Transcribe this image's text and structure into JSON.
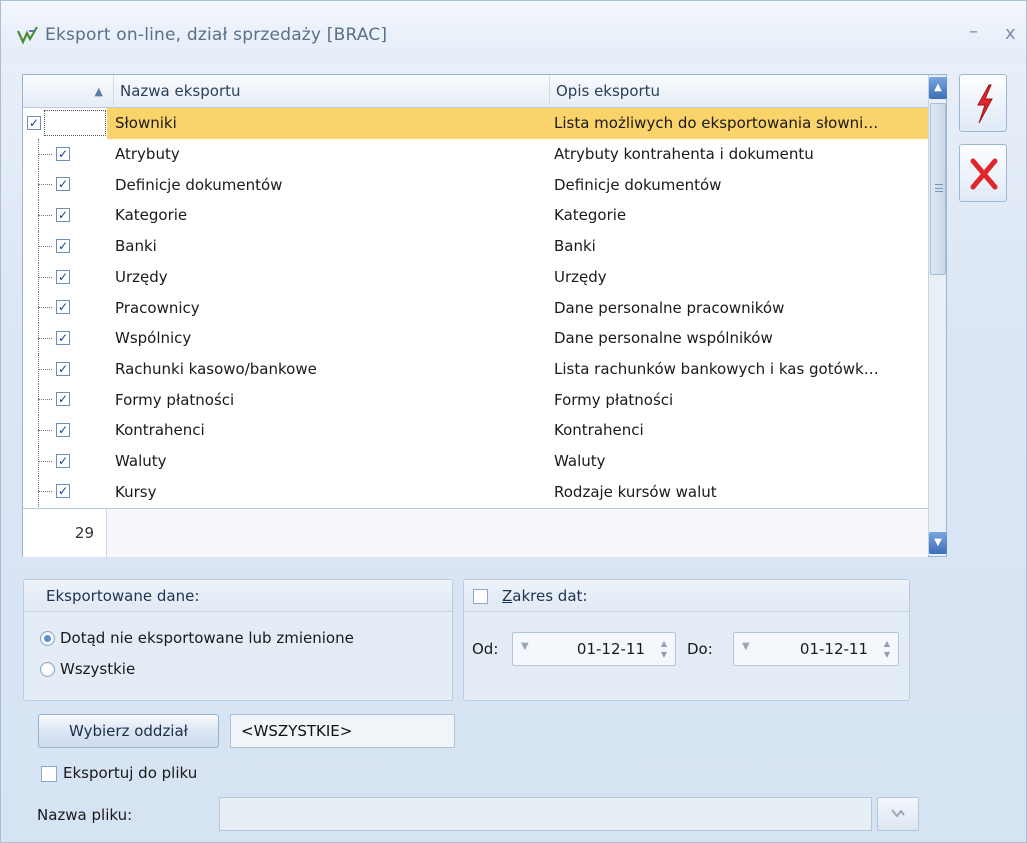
{
  "window": {
    "title": "Eksport on-line, dział sprzedaży [BRAC]",
    "minimize": "–",
    "close": "x"
  },
  "grid": {
    "sort_indicator": "▲",
    "columns": [
      "Nazwa eksportu",
      "Opis eksportu"
    ],
    "rows": [
      {
        "name": "Słowniki",
        "desc": "Lista możliwych do eksportowania słowni…",
        "checked": true,
        "level": 0,
        "selected": true
      },
      {
        "name": "Atrybuty",
        "desc": "Atrybuty kontrahenta i dokumentu",
        "checked": true,
        "level": 1
      },
      {
        "name": "Definicje dokumentów",
        "desc": "Definicje dokumentów",
        "checked": true,
        "level": 1
      },
      {
        "name": "Kategorie",
        "desc": "Kategorie",
        "checked": true,
        "level": 1
      },
      {
        "name": "Banki",
        "desc": "Banki",
        "checked": true,
        "level": 1
      },
      {
        "name": "Urzędy",
        "desc": "Urzędy",
        "checked": true,
        "level": 1
      },
      {
        "name": "Pracownicy",
        "desc": "Dane personalne pracowników",
        "checked": true,
        "level": 1
      },
      {
        "name": "Wspólnicy",
        "desc": "Dane personalne wspólników",
        "checked": true,
        "level": 1
      },
      {
        "name": "Rachunki kasowo/bankowe",
        "desc": "Lista rachunków bankowych i kas gotówk…",
        "checked": true,
        "level": 1
      },
      {
        "name": "Formy płatności",
        "desc": "Formy płatności",
        "checked": true,
        "level": 1
      },
      {
        "name": "Kontrahenci",
        "desc": "Kontrahenci",
        "checked": true,
        "level": 1
      },
      {
        "name": "Waluty",
        "desc": "Waluty",
        "checked": true,
        "level": 1
      },
      {
        "name": "Kursy",
        "desc": "Rodzaje kursów walut",
        "checked": true,
        "level": 1
      }
    ],
    "count": "29"
  },
  "actions": {
    "run_icon": "lightning-icon",
    "cancel_icon": "x-icon",
    "run_color": "#e0262b",
    "cancel_color": "#e0262b"
  },
  "exported_data": {
    "title": "Eksportowane dane:",
    "options": [
      "Dotąd nie eksportowane lub zmienione",
      "Wszystkie"
    ],
    "selected_index": 0
  },
  "date_range": {
    "title_prefix": "Z",
    "title_rest": "akres dat:",
    "checked": false,
    "from_label": "Od:",
    "from_value": "01-12-11",
    "to_label": "Do:",
    "to_value": "01-12-11"
  },
  "branch": {
    "button_label": "Wybierz oddział",
    "value": "<WSZYSTKIE>"
  },
  "file_export": {
    "checkbox_label": "Eksportuj do pliku",
    "checked": false,
    "file_label": "Nazwa pliku:",
    "file_value": ""
  }
}
